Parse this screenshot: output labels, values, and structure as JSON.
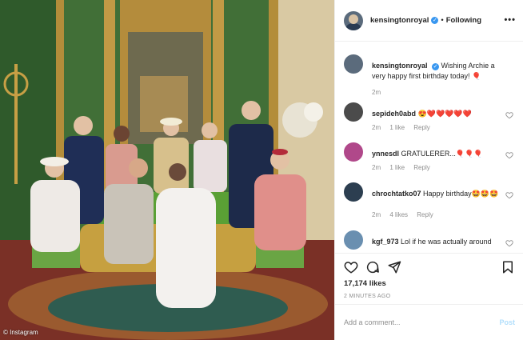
{
  "photo": {
    "alt_icon": "family-portrait-photo",
    "watermark": "© Instagram",
    "colors": {
      "wall": "#3f7a3a",
      "gold": "#b8923a",
      "floor": "#8a3b2b"
    }
  },
  "header": {
    "username": "kensingtonroyal",
    "verified": "✓",
    "separator": "•",
    "follow_label": "Following",
    "more_label": "•••"
  },
  "caption": {
    "username": "kensingtonroyal",
    "text": "Wishing Archie a very happy first birthday today!",
    "emoji": "🎈",
    "time": "2m"
  },
  "comments": [
    {
      "username": "sepideh0abd",
      "text": "😍❤️❤️❤️❤️❤️",
      "time": "2m",
      "likes": "1 like",
      "reply": "Reply",
      "avatar_color": "#4b4b4b"
    },
    {
      "username": "ynnesdl",
      "text": "GRATULERER...🎈🎈🎈",
      "time": "2m",
      "likes": "1 like",
      "reply": "Reply",
      "avatar_color": "#b0488a"
    },
    {
      "username": "chrochtatko07",
      "text": "Happy birthday🤩🤩🤩",
      "time": "2m",
      "likes": "4 likes",
      "reply": "Reply",
      "avatar_color": "#2c3e50"
    },
    {
      "username": "kgf_973",
      "text": "Lol if he was actually around",
      "time": "",
      "likes": "",
      "reply": "",
      "avatar_color": "#6a8fb0"
    }
  ],
  "actions": {
    "likes": "17,174 likes",
    "ago": "2 MINUTES AGO"
  },
  "add_comment": {
    "placeholder": "Add a comment...",
    "post_label": "Post"
  }
}
